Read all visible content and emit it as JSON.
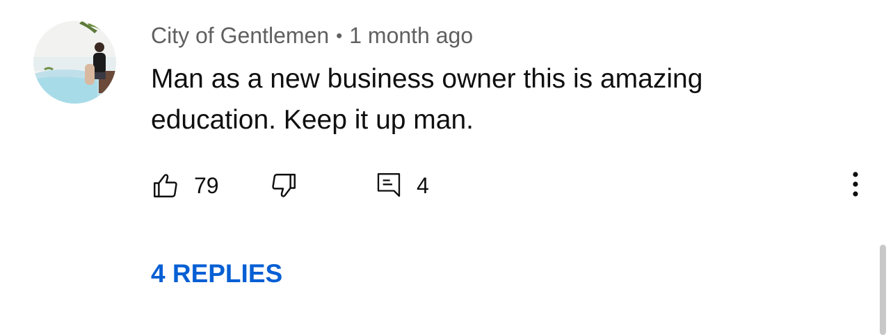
{
  "comment": {
    "author": "City of Gentlemen",
    "separator": "•",
    "time_ago": "1 month ago",
    "text": "Man as a new business owner this is amazing education. Keep it up man.",
    "likes": "79",
    "replies_count": "4",
    "replies_label": "4 REPLIES"
  },
  "icons": {
    "like": "thumbs-up-icon",
    "dislike": "thumbs-down-icon",
    "reply": "comment-icon",
    "more": "more-vertical-icon"
  },
  "colors": {
    "replies_link": "#065fd4",
    "meta_text": "#606060",
    "body_text": "#0f0f0f"
  }
}
